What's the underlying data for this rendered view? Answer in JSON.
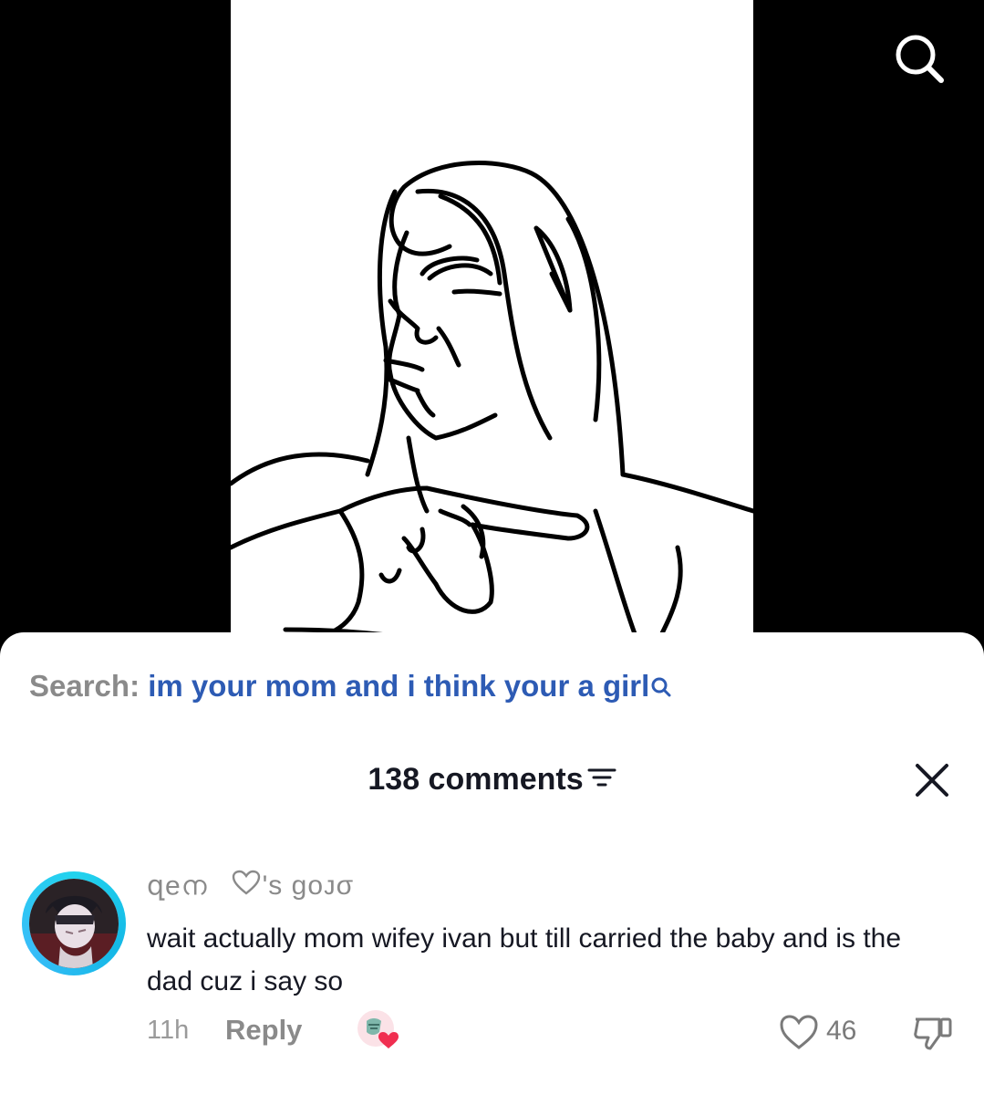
{
  "video": {
    "search_icon": "search-icon"
  },
  "search_suggestion": {
    "label": "Search:",
    "query": "im your mom and i think your a girl",
    "icon": "search-icon",
    "color": "#2d5bb4"
  },
  "comments_panel": {
    "count_label": "138 comments",
    "filter_icon": "filter-icon",
    "close_icon": "close-icon"
  },
  "comment": {
    "username_part1": "զeന",
    "username_part2": "'s ɡᴏᴊσ",
    "username_icon": "heart-outline-icon",
    "text": "wait actually mom wifey ivan but till carried the baby and is the dad cuz i say so",
    "time": "11h",
    "reply_label": "Reply",
    "like_count": "46",
    "ring_color": "#22d3ee"
  }
}
